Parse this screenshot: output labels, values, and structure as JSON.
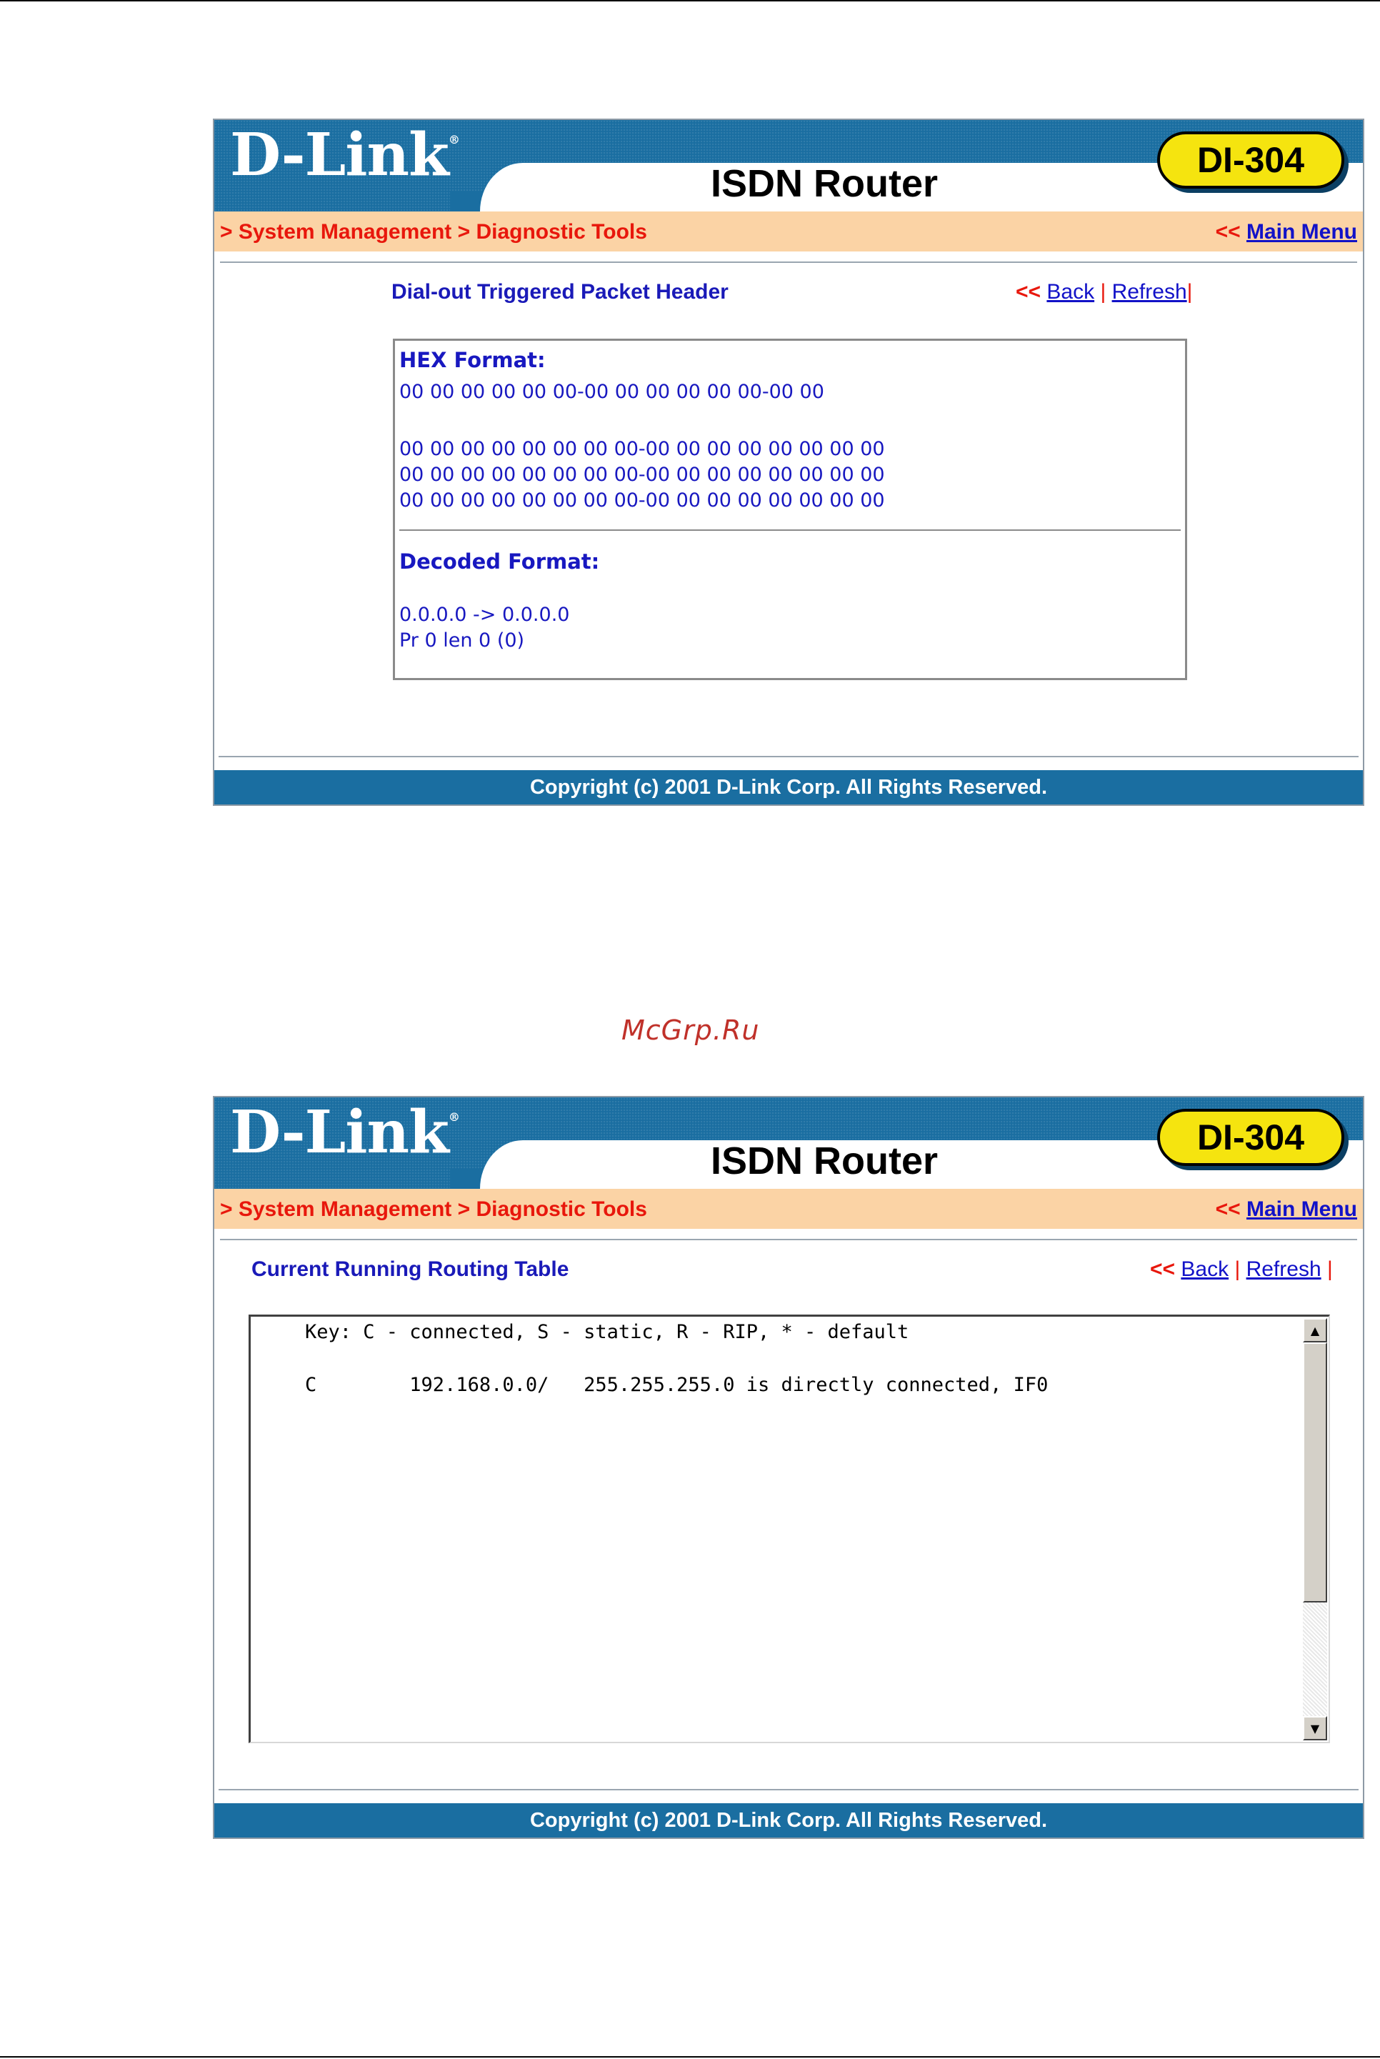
{
  "watermark": "McGrp.Ru",
  "header": {
    "logo": "D-Link",
    "logo_reg": "®",
    "product": "ISDN Router",
    "model": "DI-304"
  },
  "nav": {
    "breadcrumb": "> System Management > Diagnostic Tools",
    "main_menu_prefix": "<<",
    "main_menu_label": "Main Menu"
  },
  "links": {
    "chev": "<<",
    "back": "Back",
    "sep": "|",
    "refresh": "Refresh"
  },
  "packet_page": {
    "title": "Dial-out Triggered Packet Header",
    "hex_label": "HEX Format:",
    "hex_lines": [
      "00 00 00 00 00 00-00 00 00 00 00 00-00 00",
      "00 00 00 00 00 00 00 00-00 00 00 00 00 00 00 00",
      "00 00 00 00 00 00 00 00-00 00 00 00 00 00 00 00",
      "00 00 00 00 00 00 00 00-00 00 00 00 00 00 00 00"
    ],
    "decoded_label": "Decoded Format:",
    "decoded_lines": [
      "0.0.0.0 -> 0.0.0.0",
      "Pr 0 len 0 (0)"
    ]
  },
  "routing_page": {
    "title": "Current Running Routing Table",
    "key_line": "Key: C - connected, S - static, R - RIP, * - default",
    "row_line": "C        192.168.0.0/   255.255.255.0 is directly connected, IF0"
  },
  "footer": {
    "copyright": "Copyright (c) 2001 D-Link Corp. All Rights Reserved."
  },
  "scrollbar": {
    "up_icon": "▲",
    "down_icon": "▼"
  }
}
